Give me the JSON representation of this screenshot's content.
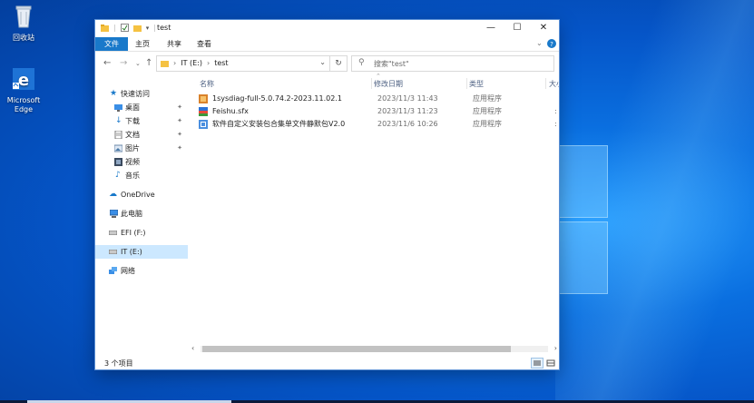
{
  "desktop": {
    "recycle_bin_label": "回收站",
    "edge_label": "Microsoft Edge"
  },
  "window": {
    "title": "test",
    "controls": {
      "minimize": "—",
      "maximize": "☐",
      "close": "✕"
    }
  },
  "ribbon": {
    "tabs": [
      "文件",
      "主页",
      "共享",
      "查看"
    ]
  },
  "address_bar": {
    "segments": [
      "IT (E:)",
      "test"
    ],
    "search_placeholder": "搜索\"test\""
  },
  "nav": {
    "quick_access": "快速访问",
    "items": [
      "桌面",
      "下载",
      "文档",
      "图片",
      "视频",
      "音乐"
    ],
    "onedrive": "OneDrive",
    "this_pc": "此电脑",
    "efi": "EFI (F:)",
    "it": "IT (E:)",
    "network": "网络"
  },
  "columns": {
    "name": "名称",
    "date": "修改日期",
    "type": "类型",
    "size": "大小"
  },
  "files": [
    {
      "name": "1sysdiag-full-5.0.74.2-2023.11.02.1",
      "date": "2023/11/3 11:43",
      "type": "应用程序",
      "icon": "installer-icon"
    },
    {
      "name": "Feishu.sfx",
      "date": "2023/11/3 11:23",
      "type": "应用程序",
      "icon": "feishu-icon"
    },
    {
      "name": "软件自定义安装包合集单文件静默包V2.0",
      "date": "2023/11/6 10:26",
      "type": "应用程序",
      "icon": "app-icon"
    }
  ],
  "status": {
    "item_count": "3 个项目"
  },
  "colors": {
    "ribbon_file_tab": "#1979ca",
    "selection": "#cce8ff",
    "desktop": "#0a6fe0"
  }
}
